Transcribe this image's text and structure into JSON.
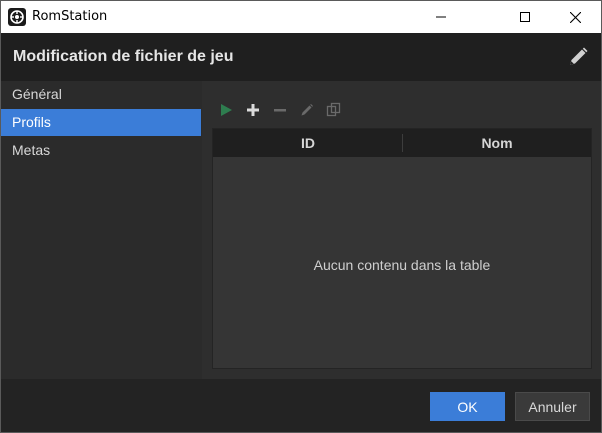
{
  "window": {
    "title": "RomStation"
  },
  "header": {
    "title": "Modification de fichier de jeu"
  },
  "sidebar": {
    "items": [
      {
        "label": "Général",
        "active": false
      },
      {
        "label": "Profils",
        "active": true
      },
      {
        "label": "Metas",
        "active": false
      }
    ]
  },
  "toolbar": {
    "icons": [
      "play-icon",
      "plus-icon",
      "minus-icon",
      "pencil-icon",
      "copy-icon"
    ]
  },
  "table": {
    "columns": [
      "ID",
      "Nom"
    ],
    "empty_message": "Aucun contenu dans la table"
  },
  "footer": {
    "ok_label": "OK",
    "cancel_label": "Annuler"
  },
  "colors": {
    "accent": "#3b7dd8",
    "play_green": "#2e7d4f"
  }
}
